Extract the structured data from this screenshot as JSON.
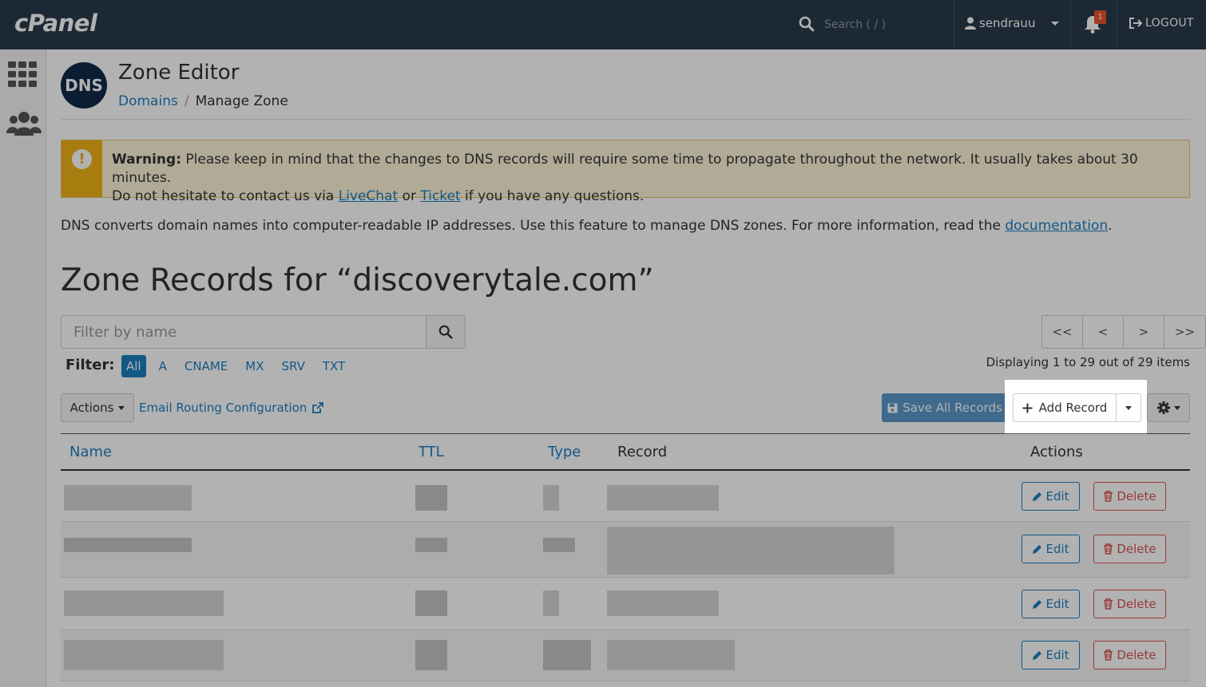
{
  "app": {
    "logo": "cPanel"
  },
  "topbar": {
    "search_placeholder": "Search ( / )",
    "username": "sendrauu",
    "notification_count": "1",
    "logout_label": "LOGOUT"
  },
  "header": {
    "badge": "DNS",
    "title": "Zone Editor",
    "breadcrumb": {
      "parent": "Domains",
      "separator": "/",
      "current": "Manage Zone"
    }
  },
  "warning": {
    "strong": "Warning:",
    "line1": " Please keep in mind that the changes to DNS records will require some time to propagate throughout the network. It usually takes about 30 minutes.",
    "line2_pre": "Do not hesitate to contact us via ",
    "livechat": "LiveChat",
    "or": " or ",
    "ticket": "Ticket",
    "line2_post": " if you have any questions."
  },
  "intro": {
    "text": "DNS converts domain names into computer-readable IP addresses. Use this feature to manage DNS zones. For more information, read the ",
    "link": "documentation",
    "end": "."
  },
  "zone": {
    "title": "Zone Records for “discoverytale.com”"
  },
  "filter": {
    "placeholder": "Filter by name",
    "label": "Filter:",
    "types": [
      "All",
      "A",
      "CNAME",
      "MX",
      "SRV",
      "TXT"
    ],
    "active": "All"
  },
  "pager": {
    "first": "<<",
    "prev": "<",
    "next": ">",
    "last": ">>"
  },
  "displaying": "Displaying 1 to 29 out of 29 items",
  "toolbar": {
    "actions_label": "Actions",
    "email_routing": "Email Routing Configuration",
    "save_all": "Save All Records",
    "add_record": "Add Record"
  },
  "table": {
    "columns": {
      "name": "Name",
      "ttl": "TTL",
      "type": "Type",
      "record": "Record",
      "actions": "Actions"
    },
    "edit_label": "Edit",
    "delete_label": "Delete"
  },
  "colors": {
    "topbar": "#293a4a",
    "link": "#1d7fc0",
    "danger": "#d9534f",
    "warning": "#f0b418"
  }
}
